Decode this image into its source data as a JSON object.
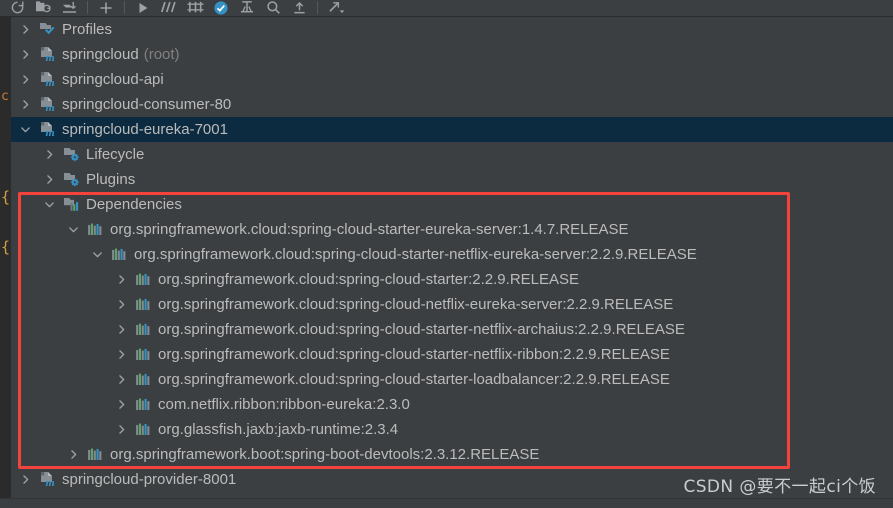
{
  "window": {
    "title": "Maven Projects Tool Window",
    "background_color": "#3c3f41",
    "selection_color": "#0d2b40",
    "text_color": "#bbbbbb",
    "muted_text_color": "#808080",
    "annotation_color": "#f4433c"
  },
  "toolbar": {
    "buttons": [
      {
        "name": "reimport-icon",
        "label": "Reimport All Maven Projects"
      },
      {
        "name": "generate-sources-icon",
        "label": "Generate Sources and Update Folders"
      },
      {
        "name": "download-sources-icon",
        "label": "Download Sources and Documentation"
      },
      {
        "name": "add-icon",
        "label": "Add Maven Projects"
      },
      {
        "name": "run-icon",
        "label": "Run Maven Build"
      },
      {
        "name": "skip-tests-icon",
        "label": "Toggle Skip Tests Mode"
      },
      {
        "name": "execute-goal-icon",
        "label": "Execute Maven Goal"
      },
      {
        "name": "offline-mode-icon",
        "label": "Toggle Offline Mode"
      },
      {
        "name": "show-dependencies-icon",
        "label": "Show Dependencies"
      },
      {
        "name": "search-icon",
        "label": "Search"
      },
      {
        "name": "collapse-all-icon",
        "label": "Collapse All"
      },
      {
        "name": "settings-icon",
        "label": "Maven Settings"
      }
    ]
  },
  "editor_sliver": {
    "glyphs": [
      "c",
      "{",
      "{"
    ]
  },
  "tree": [
    {
      "id": "profiles",
      "label": "Profiles",
      "suffix": "",
      "indent": 0,
      "arrow": "collapsed",
      "icon": "profiles-folder-icon",
      "selected": false
    },
    {
      "id": "springcloud-root",
      "label": "springcloud",
      "suffix": "(root)",
      "indent": 0,
      "arrow": "collapsed",
      "icon": "maven-module-icon",
      "selected": false
    },
    {
      "id": "springcloud-api",
      "label": "springcloud-api",
      "suffix": "",
      "indent": 0,
      "arrow": "collapsed",
      "icon": "maven-module-icon",
      "selected": false
    },
    {
      "id": "springcloud-consumer-80",
      "label": "springcloud-consumer-80",
      "suffix": "",
      "indent": 0,
      "arrow": "collapsed",
      "icon": "maven-module-icon",
      "selected": false
    },
    {
      "id": "springcloud-eureka-7001",
      "label": "springcloud-eureka-7001",
      "suffix": "",
      "indent": 0,
      "arrow": "expanded",
      "icon": "maven-module-icon",
      "selected": true
    },
    {
      "id": "lifecycle",
      "label": "Lifecycle",
      "suffix": "",
      "indent": 1,
      "arrow": "collapsed",
      "icon": "lifecycle-folder-icon",
      "selected": false
    },
    {
      "id": "plugins",
      "label": "Plugins",
      "suffix": "",
      "indent": 1,
      "arrow": "collapsed",
      "icon": "plugins-folder-icon",
      "selected": false
    },
    {
      "id": "dependencies",
      "label": "Dependencies",
      "suffix": "",
      "indent": 1,
      "arrow": "expanded",
      "icon": "dependencies-folder-icon",
      "selected": false
    },
    {
      "id": "dep-starter-eureka-server",
      "label": "org.springframework.cloud:spring-cloud-starter-eureka-server:1.4.7.RELEASE",
      "suffix": "",
      "indent": 2,
      "arrow": "expanded",
      "icon": "dependency-icon",
      "selected": false
    },
    {
      "id": "dep-starter-netflix-eureka-server",
      "label": "org.springframework.cloud:spring-cloud-starter-netflix-eureka-server:2.2.9.RELEASE",
      "suffix": "",
      "indent": 3,
      "arrow": "expanded",
      "icon": "dependency-icon",
      "selected": false
    },
    {
      "id": "dep-starter",
      "label": "org.springframework.cloud:spring-cloud-starter:2.2.9.RELEASE",
      "suffix": "",
      "indent": 4,
      "arrow": "collapsed",
      "icon": "dependency-icon",
      "selected": false
    },
    {
      "id": "dep-netflix-eureka-server",
      "label": "org.springframework.cloud:spring-cloud-netflix-eureka-server:2.2.9.RELEASE",
      "suffix": "",
      "indent": 4,
      "arrow": "collapsed",
      "icon": "dependency-icon",
      "selected": false
    },
    {
      "id": "dep-starter-netflix-archaius",
      "label": "org.springframework.cloud:spring-cloud-starter-netflix-archaius:2.2.9.RELEASE",
      "suffix": "",
      "indent": 4,
      "arrow": "collapsed",
      "icon": "dependency-icon",
      "selected": false
    },
    {
      "id": "dep-starter-netflix-ribbon",
      "label": "org.springframework.cloud:spring-cloud-starter-netflix-ribbon:2.2.9.RELEASE",
      "suffix": "",
      "indent": 4,
      "arrow": "collapsed",
      "icon": "dependency-icon",
      "selected": false
    },
    {
      "id": "dep-starter-loadbalancer",
      "label": "org.springframework.cloud:spring-cloud-starter-loadbalancer:2.2.9.RELEASE",
      "suffix": "",
      "indent": 4,
      "arrow": "collapsed",
      "icon": "dependency-icon",
      "selected": false
    },
    {
      "id": "dep-ribbon-eureka",
      "label": "com.netflix.ribbon:ribbon-eureka:2.3.0",
      "suffix": "",
      "indent": 4,
      "arrow": "collapsed",
      "icon": "dependency-icon",
      "selected": false
    },
    {
      "id": "dep-jaxb-runtime",
      "label": "org.glassfish.jaxb:jaxb-runtime:2.3.4",
      "suffix": "",
      "indent": 4,
      "arrow": "collapsed",
      "icon": "dependency-icon",
      "selected": false
    },
    {
      "id": "dep-spring-boot-devtools",
      "label": "org.springframework.boot:spring-boot-devtools:2.3.12.RELEASE",
      "suffix": "",
      "indent": 2,
      "arrow": "collapsed",
      "icon": "dependency-icon",
      "selected": false
    },
    {
      "id": "springcloud-provider-8001",
      "label": "springcloud-provider-8001",
      "suffix": "",
      "indent": 0,
      "arrow": "collapsed",
      "icon": "maven-module-icon",
      "selected": false
    }
  ],
  "watermark": {
    "text": "CSDN @要不一起ci个饭"
  }
}
